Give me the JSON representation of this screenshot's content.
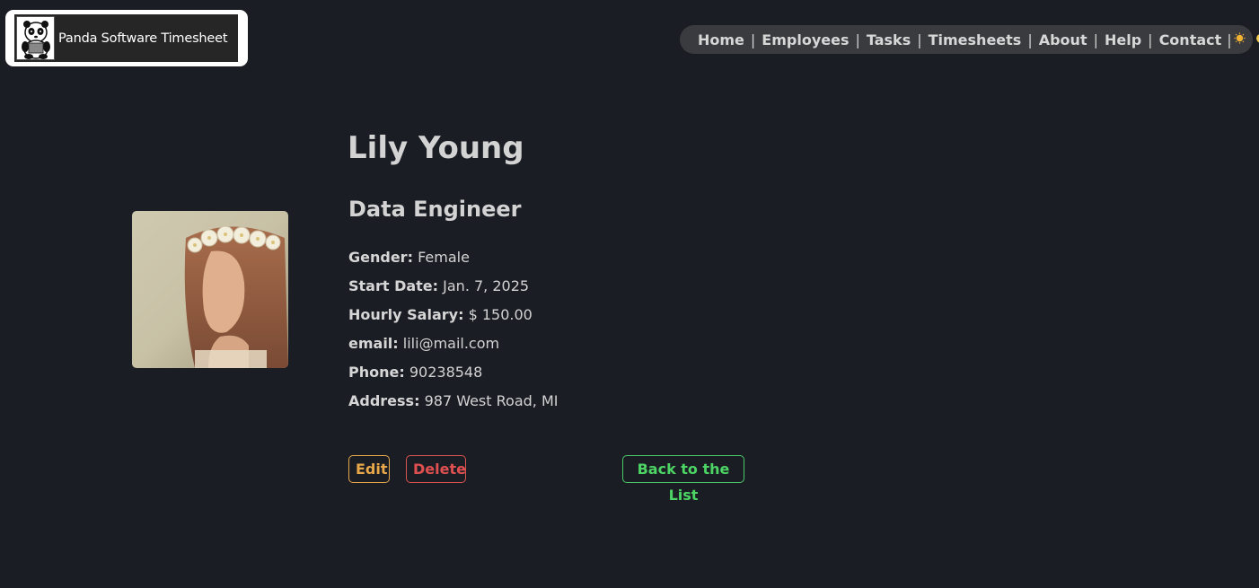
{
  "brand": {
    "title": "Panda Software Timesheet",
    "logo_icon": "panda-logo-icon"
  },
  "nav": {
    "links": [
      "Home",
      "Employees",
      "Tasks",
      "Timesheets",
      "About",
      "Help",
      "Contact"
    ],
    "separator": "|",
    "theme_toggle": {
      "sun_icon": "sun-icon",
      "moon_icon": "moon-icon",
      "mode": "dark"
    }
  },
  "employee": {
    "name": "Lily Young",
    "role": "Data Engineer",
    "photo_icon": "employee-photo",
    "details": [
      {
        "label": "Gender:",
        "value": "Female"
      },
      {
        "label": "Start Date:",
        "value": "Jan. 7, 2025"
      },
      {
        "label": "Hourly Salary:",
        "value": "$ 150.00"
      },
      {
        "label": "email:",
        "value": "lili@mail.com"
      },
      {
        "label": "Phone:",
        "value": "90238548"
      },
      {
        "label": "Address:",
        "value": "987 West Road, MI"
      }
    ]
  },
  "actions": {
    "edit": "Edit",
    "delete": "Delete",
    "back": "Back to the List"
  },
  "colors": {
    "background": "#1b1d24",
    "edit": "#e8a84a",
    "delete": "#e05050",
    "back": "#4cd464"
  }
}
